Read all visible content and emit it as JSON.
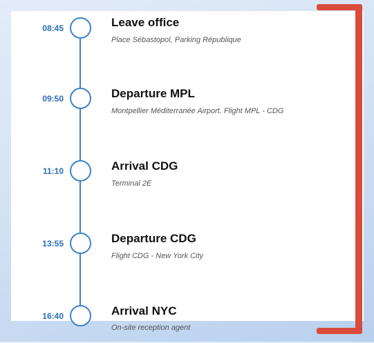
{
  "timeline": {
    "events": [
      {
        "time": "08:45",
        "title": "Leave office",
        "subtitle": "Place Sébastopol, Parking République"
      },
      {
        "time": "09:50",
        "title": "Departure MPL",
        "subtitle": "Montpellier Méditerranée Airport. Flight MPL - CDG"
      },
      {
        "time": "11:10",
        "title": "Arrival CDG",
        "subtitle": "Terminal 2E"
      },
      {
        "time": "13:55",
        "title": "Departure CDG",
        "subtitle": "Flight CDG - New York City"
      },
      {
        "time": "16:40",
        "title": "Arrival NYC",
        "subtitle": "On-site reception agent"
      }
    ]
  },
  "colors": {
    "timeline_blue": "#3b82c9",
    "time_text": "#2d6db4",
    "bracket_red": "#d94b3b",
    "card_bg": "#ffffff"
  }
}
